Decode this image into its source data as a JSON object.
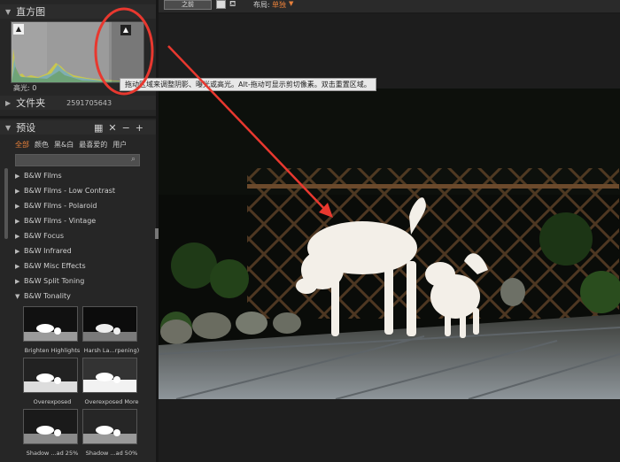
{
  "histogram": {
    "title": "直方图",
    "clip_label": "高光: 0"
  },
  "folder": {
    "label": "文件夹",
    "value": "2591705643"
  },
  "presets": {
    "title": "预设",
    "categories": [
      "全部",
      "颜色",
      "黑&白",
      "最喜爱的",
      "用户"
    ],
    "items": [
      "B&W Films",
      "B&W Films - Low Contrast",
      "B&W Films - Polaroid",
      "B&W Films - Vintage",
      "B&W Focus",
      "B&W Infrared",
      "B&W Misc Effects",
      "B&W Split Toning",
      "B&W Tonality"
    ],
    "thumbnails": [
      "Brighten Highlights",
      "Harsh La...rpening)",
      "Overexposed",
      "Overexposed More",
      "Shadow ...ad  25%",
      "Shadow ...ad  50%"
    ]
  },
  "toolbar": {
    "before_label": "之前",
    "layout_label": "布局:",
    "layout_value": "单独"
  },
  "tooltip": {
    "text": "拖动区域来调整阴影、曝光或高光。Alt-拖动可显示剪切像素。双击重置区域。"
  },
  "colors": {
    "accent": "#e8803a",
    "annotation": "#e8382f"
  }
}
